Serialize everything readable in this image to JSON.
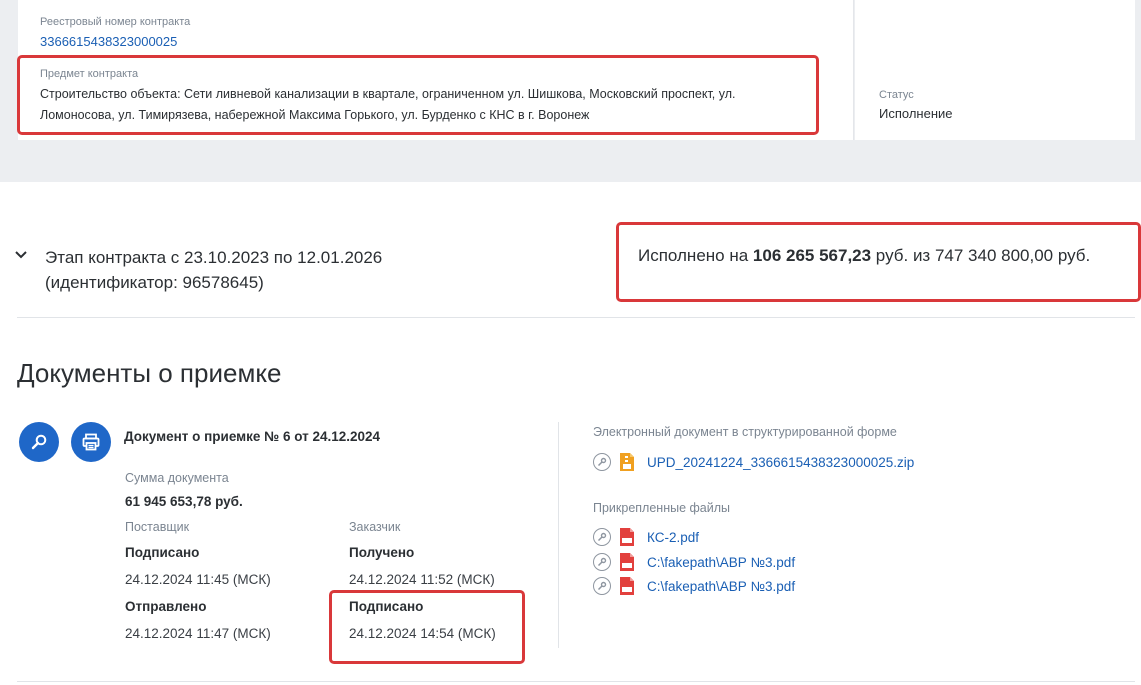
{
  "contract": {
    "reg_label": "Реестровый номер контракта",
    "reg_number": "3366615438323000025",
    "subject_label": "Предмет контракта",
    "subject_text": "Строительство объекта: Сети ливневой канализации в квартале, ограниченном ул. Шишкова, Московский проспект, ул. Ломоносова, ул. Тимирязева, набережной Максима Горького, ул. Бурденко с КНС в г. Воронеж",
    "status_label": "Статус",
    "status_value": "Исполнение"
  },
  "stage": {
    "title_line1": "Этап контракта с 23.10.2023 по 12.01.2026",
    "title_line2": "(идентификатор: 96578645)",
    "exec_prefix": "Исполнено на ",
    "exec_amount": "106 265 567,23",
    "exec_suffix": " руб. из 747 340 800,00 руб."
  },
  "docs": {
    "section_title": "Документы о приемке",
    "doc_name": "Документ о приемке № 6 от 24.12.2024",
    "sum_label": "Сумма документа",
    "sum_value": "61 945 653,78 руб.",
    "supplier_label": "Поставщик",
    "customer_label": "Заказчик",
    "supplier_status1": "Подписано",
    "supplier_date1": "24.12.2024 11:45 (МСК)",
    "supplier_status2": "Отправлено",
    "supplier_date2": "24.12.2024 11:47 (МСК)",
    "customer_status1": "Получено",
    "customer_date1": "24.12.2024 11:52 (МСК)",
    "customer_status2": "Подписано",
    "customer_date2": "24.12.2024 14:54 (МСК)",
    "edoc_label": "Электронный документ в структурированной форме",
    "edoc_file": "UPD_20241224_3366615438323000025.zip",
    "attached_label": "Прикрепленные файлы",
    "attached_files": [
      "КС-2.pdf",
      "C:\\fakepath\\АВР №3.pdf",
      "C:\\fakepath\\АВР №3.pdf"
    ]
  },
  "colors": {
    "accent": "#1f67c8",
    "link": "#1a5fb4",
    "highlight": "#d9383a",
    "pdf": "#e2403d",
    "zip": "#f0a020"
  },
  "icons": {
    "search": "search-icon",
    "print": "printer-icon",
    "key": "key-icon",
    "zip": "zip-file-icon",
    "pdf": "pdf-file-icon",
    "chevron": "chevron-down-icon"
  }
}
